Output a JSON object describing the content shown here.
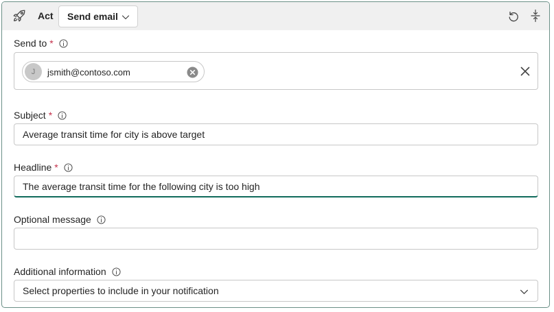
{
  "header": {
    "title": "Act",
    "action_type": "Send email"
  },
  "send_to": {
    "label": "Send to",
    "required_mark": "*",
    "recipients": [
      {
        "initial": "J",
        "email": "jsmith@contoso.com"
      }
    ]
  },
  "subject": {
    "label": "Subject",
    "required_mark": "*",
    "value": "Average transit time for city is above target"
  },
  "headline": {
    "label": "Headline",
    "required_mark": "*",
    "value": "The average transit time for the following city is too high"
  },
  "optional_message": {
    "label": "Optional message",
    "value": ""
  },
  "additional_info": {
    "label": "Additional information",
    "placeholder": "Select properties to include in your notification"
  },
  "colors": {
    "required": "#c4314b",
    "accent": "#0f6a5b",
    "border": "#6a8f86"
  },
  "icons": [
    "rocket-icon",
    "chevron-down-icon",
    "undo-icon",
    "collapse-icon",
    "info-icon",
    "dismiss-circle-icon",
    "close-icon"
  ]
}
